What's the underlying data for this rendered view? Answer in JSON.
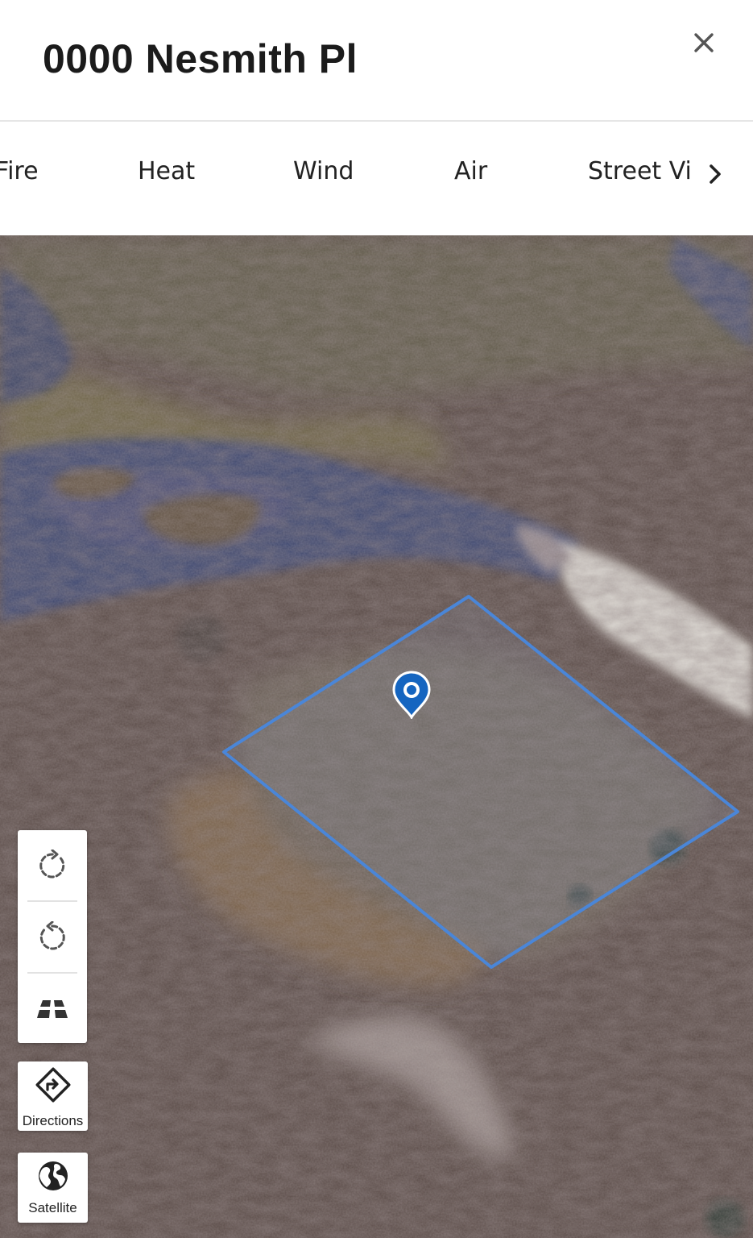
{
  "header": {
    "title": "0000 Nesmith Pl",
    "close_icon": "close-icon"
  },
  "tabs": {
    "items": [
      {
        "label": "Fire"
      },
      {
        "label": "Heat"
      },
      {
        "label": "Wind"
      },
      {
        "label": "Air"
      },
      {
        "label": "Street View"
      }
    ],
    "next_icon": "chevron-right-icon"
  },
  "map": {
    "view": "satellite",
    "parcel_outline_color": "#4a86d8",
    "marker_color": "#1565c0",
    "controls": {
      "rotate_right_icon": "rotate-clockwise-icon",
      "rotate_left_icon": "rotate-counterclockwise-icon",
      "tilt_icon": "tilt-3d-icon",
      "directions_label": "Directions",
      "satellite_label": "Satellite"
    }
  }
}
